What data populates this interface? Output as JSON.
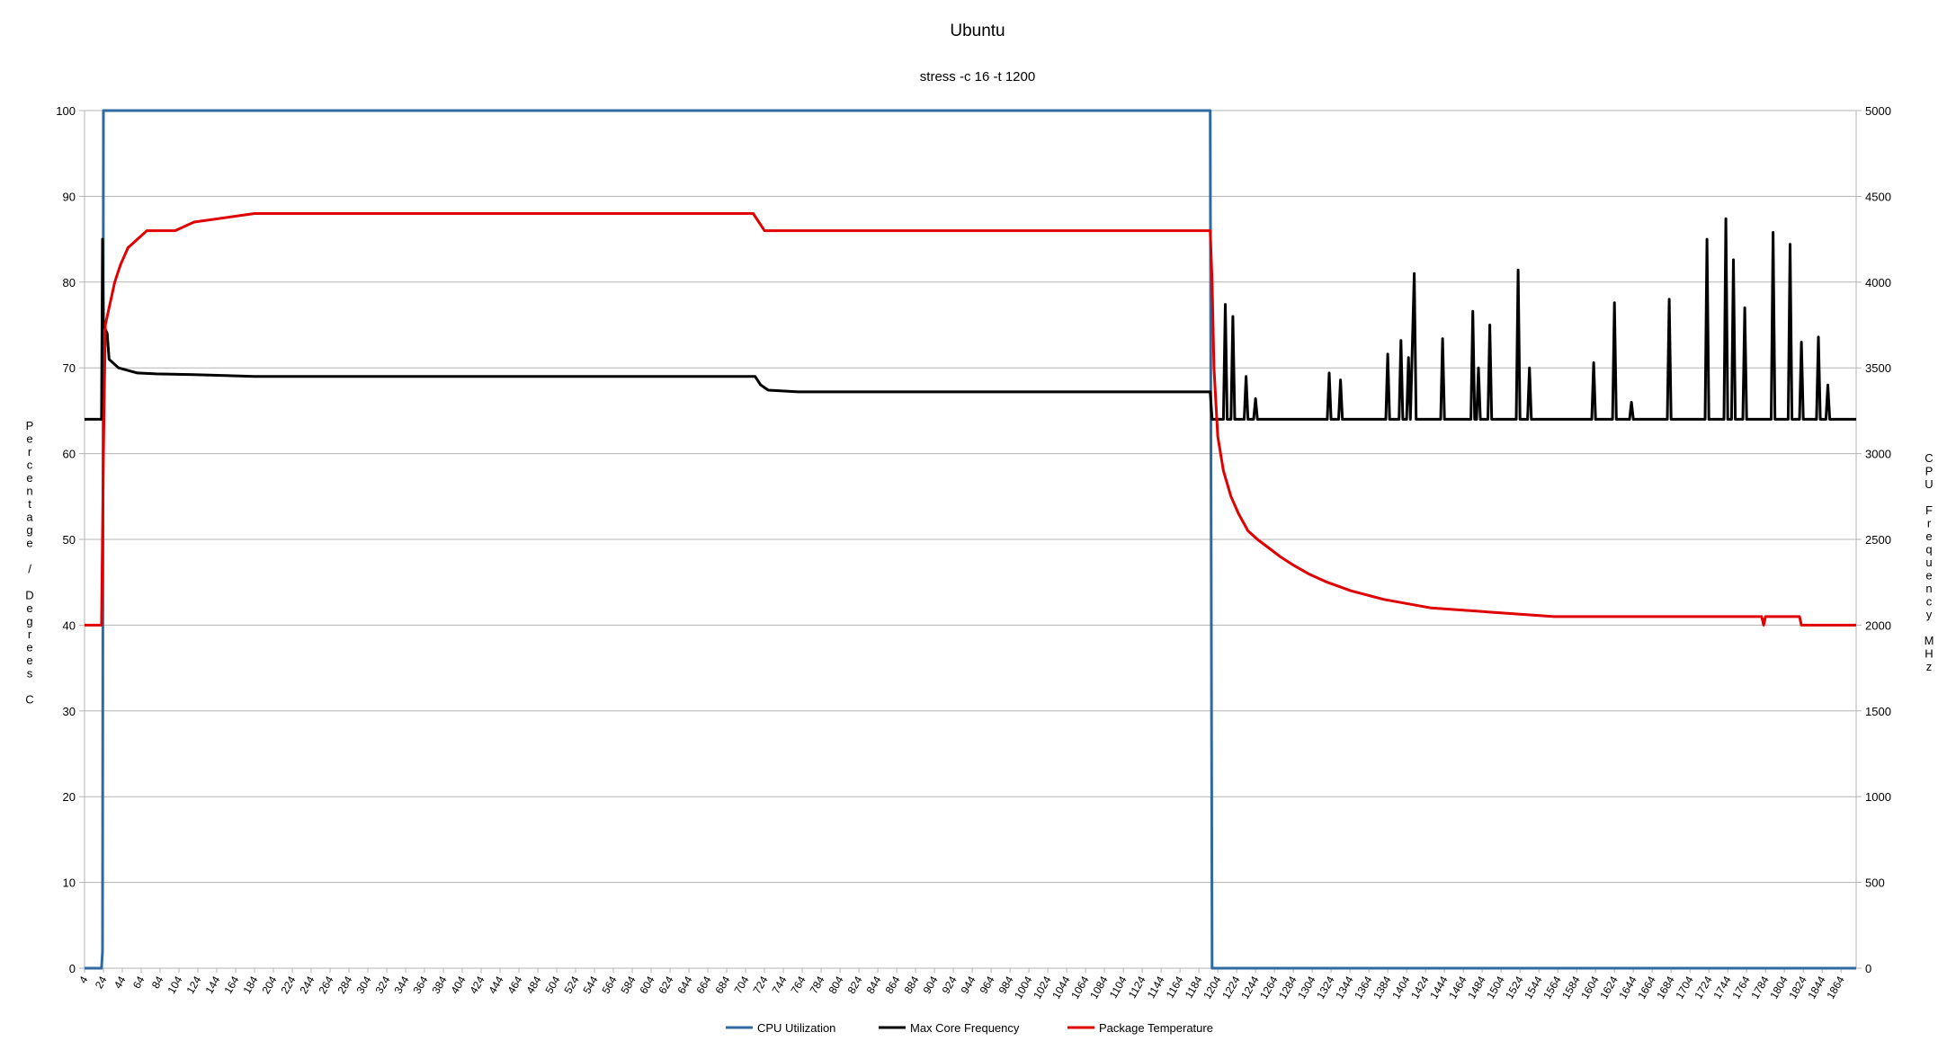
{
  "chart_data": {
    "type": "line",
    "title": "Ubuntu",
    "subtitle": "stress -c 16 -t 1200",
    "ylabel_left": "Percentage / Degrees C",
    "ylabel_right": "CPU Frequency MHz",
    "ylim_left": [
      0,
      100
    ],
    "ylim_right": [
      0,
      5000
    ],
    "xlim": [
      4,
      1880
    ],
    "y_ticks_left": [
      0,
      10,
      20,
      30,
      40,
      50,
      60,
      70,
      80,
      90,
      100
    ],
    "y_ticks_right": [
      0,
      500,
      1000,
      1500,
      2000,
      2500,
      3000,
      3500,
      4000,
      4500,
      5000
    ],
    "x_tick_start": 4,
    "x_tick_step": 20,
    "x_tick_end": 1864,
    "grid": true,
    "legend_position": "bottom",
    "series": [
      {
        "name": "CPU Utilization",
        "axis": "left",
        "color": "#2f6aa3",
        "points": [
          [
            4,
            0
          ],
          [
            22,
            0
          ],
          [
            23,
            2
          ],
          [
            24,
            100
          ],
          [
            1196,
            100
          ],
          [
            1198,
            0
          ],
          [
            1880,
            0
          ]
        ]
      },
      {
        "name": "Max Core Frequency",
        "axis": "right",
        "color": "#000000",
        "points": [
          [
            4,
            3200
          ],
          [
            22,
            3200
          ],
          [
            23,
            4250
          ],
          [
            24,
            3750
          ],
          [
            28,
            3700
          ],
          [
            30,
            3550
          ],
          [
            40,
            3500
          ],
          [
            60,
            3470
          ],
          [
            80,
            3465
          ],
          [
            120,
            3460
          ],
          [
            184,
            3450
          ],
          [
            400,
            3450
          ],
          [
            714,
            3450
          ],
          [
            720,
            3400
          ],
          [
            728,
            3370
          ],
          [
            760,
            3360
          ],
          [
            1000,
            3360
          ],
          [
            1196,
            3360
          ],
          [
            1198,
            3200
          ],
          [
            1210,
            3200
          ],
          [
            1212,
            3870
          ],
          [
            1214,
            3200
          ],
          [
            1218,
            3200
          ],
          [
            1220,
            3800
          ],
          [
            1222,
            3200
          ],
          [
            1232,
            3200
          ],
          [
            1234,
            3450
          ],
          [
            1236,
            3200
          ],
          [
            1242,
            3200
          ],
          [
            1244,
            3320
          ],
          [
            1246,
            3200
          ],
          [
            1320,
            3200
          ],
          [
            1322,
            3470
          ],
          [
            1324,
            3200
          ],
          [
            1332,
            3200
          ],
          [
            1334,
            3430
          ],
          [
            1336,
            3200
          ],
          [
            1382,
            3200
          ],
          [
            1384,
            3580
          ],
          [
            1386,
            3200
          ],
          [
            1396,
            3200
          ],
          [
            1398,
            3660
          ],
          [
            1400,
            3200
          ],
          [
            1404,
            3200
          ],
          [
            1406,
            3560
          ],
          [
            1408,
            3200
          ],
          [
            1412,
            4050
          ],
          [
            1414,
            3200
          ],
          [
            1440,
            3200
          ],
          [
            1442,
            3670
          ],
          [
            1444,
            3200
          ],
          [
            1472,
            3200
          ],
          [
            1474,
            3830
          ],
          [
            1476,
            3200
          ],
          [
            1478,
            3200
          ],
          [
            1480,
            3500
          ],
          [
            1482,
            3200
          ],
          [
            1490,
            3200
          ],
          [
            1492,
            3750
          ],
          [
            1494,
            3200
          ],
          [
            1520,
            3200
          ],
          [
            1522,
            4070
          ],
          [
            1524,
            3200
          ],
          [
            1532,
            3200
          ],
          [
            1534,
            3500
          ],
          [
            1536,
            3200
          ],
          [
            1600,
            3200
          ],
          [
            1602,
            3530
          ],
          [
            1604,
            3200
          ],
          [
            1622,
            3200
          ],
          [
            1624,
            3880
          ],
          [
            1626,
            3200
          ],
          [
            1640,
            3200
          ],
          [
            1642,
            3300
          ],
          [
            1644,
            3200
          ],
          [
            1680,
            3200
          ],
          [
            1682,
            3900
          ],
          [
            1684,
            3200
          ],
          [
            1720,
            3200
          ],
          [
            1722,
            4250
          ],
          [
            1724,
            3200
          ],
          [
            1740,
            3200
          ],
          [
            1742,
            4370
          ],
          [
            1744,
            3200
          ],
          [
            1748,
            3200
          ],
          [
            1750,
            4130
          ],
          [
            1752,
            3200
          ],
          [
            1760,
            3200
          ],
          [
            1762,
            3850
          ],
          [
            1764,
            3200
          ],
          [
            1790,
            3200
          ],
          [
            1792,
            4290
          ],
          [
            1794,
            3200
          ],
          [
            1808,
            3200
          ],
          [
            1810,
            4220
          ],
          [
            1812,
            3200
          ],
          [
            1820,
            3200
          ],
          [
            1822,
            3650
          ],
          [
            1824,
            3200
          ],
          [
            1838,
            3200
          ],
          [
            1840,
            3680
          ],
          [
            1842,
            3200
          ],
          [
            1848,
            3200
          ],
          [
            1850,
            3400
          ],
          [
            1852,
            3200
          ],
          [
            1880,
            3200
          ]
        ]
      },
      {
        "name": "Package Temperature",
        "axis": "left",
        "color": "#e00000",
        "points": [
          [
            4,
            40
          ],
          [
            22,
            40
          ],
          [
            24,
            60
          ],
          [
            26,
            75
          ],
          [
            30,
            77
          ],
          [
            32,
            78
          ],
          [
            36,
            80
          ],
          [
            42,
            82
          ],
          [
            50,
            84
          ],
          [
            60,
            85
          ],
          [
            70,
            86
          ],
          [
            80,
            86
          ],
          [
            100,
            86
          ],
          [
            120,
            87
          ],
          [
            184,
            88
          ],
          [
            712,
            88
          ],
          [
            718,
            87
          ],
          [
            724,
            86
          ],
          [
            1196,
            86
          ],
          [
            1198,
            80
          ],
          [
            1200,
            70
          ],
          [
            1204,
            62
          ],
          [
            1210,
            58
          ],
          [
            1218,
            55
          ],
          [
            1226,
            53
          ],
          [
            1236,
            51
          ],
          [
            1246,
            50
          ],
          [
            1258,
            49
          ],
          [
            1270,
            48
          ],
          [
            1284,
            47
          ],
          [
            1300,
            46
          ],
          [
            1320,
            45
          ],
          [
            1345,
            44
          ],
          [
            1380,
            43
          ],
          [
            1430,
            42
          ],
          [
            1560,
            41
          ],
          [
            1780,
            41
          ],
          [
            1782,
            40
          ],
          [
            1784,
            41
          ],
          [
            1820,
            41
          ],
          [
            1822,
            40
          ],
          [
            1880,
            40
          ]
        ]
      }
    ]
  }
}
